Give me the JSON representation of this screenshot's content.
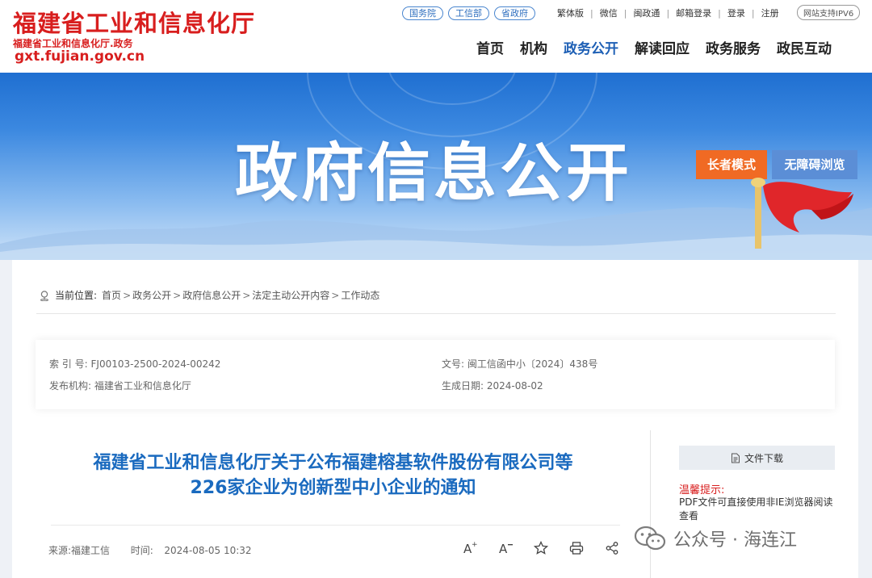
{
  "header": {
    "site_title": "福建省工业和信息化厅",
    "site_subtitle": "福建省工业和信息化厅.政务",
    "site_url": "gxt.fujian.gov.cn",
    "pills": [
      "国务院",
      "工信部",
      "省政府"
    ],
    "mini_links": [
      "繁体版",
      "微信",
      "闽政通",
      "邮箱登录",
      "登录",
      "注册"
    ],
    "ipv6": "网站支持IPV6",
    "nav": [
      {
        "label": "首页",
        "active": false
      },
      {
        "label": "机构",
        "active": false
      },
      {
        "label": "政务公开",
        "active": true
      },
      {
        "label": "解读回应",
        "active": false
      },
      {
        "label": "政务服务",
        "active": false
      },
      {
        "label": "政民互动",
        "active": false
      }
    ]
  },
  "banner": {
    "title": "政府信息公开",
    "elder_mode": "长者模式",
    "accessible": "无障碍浏览"
  },
  "breadcrumb": {
    "label": "当前位置:",
    "items": [
      "首页",
      "政务公开",
      "政府信息公开",
      "法定主动公开内容",
      "工作动态"
    ]
  },
  "meta": {
    "index_label": "索 引 号:",
    "index_value": "FJ00103-2500-2024-00242",
    "doc_label": "文号:",
    "doc_value": "闽工信函中小〔2024〕438号",
    "publisher_label": "发布机构:",
    "publisher_value": "福建省工业和信息化厅",
    "date_label": "生成日期:",
    "date_value": "2024-08-02"
  },
  "article": {
    "title_line1": "福建省工业和信息化厅关于公布福建榕基软件股份有限公司等",
    "title_line2": "226家企业为创新型中小企业的通知",
    "source": "来源:福建工信",
    "time_label": "时间:",
    "time_value": "2024-08-05 10:32"
  },
  "sidebar": {
    "download": "文件下载",
    "tip_title": "温馨提示:",
    "tip_text": "PDF文件可直接使用非IE浏览器阅读查看"
  },
  "watermark": {
    "text": "公众号 · 海连江"
  },
  "colors": {
    "brand_red": "#d81e1e",
    "nav_active": "#1d5fb5",
    "elder_btn": "#f06a24",
    "access_btn": "#5b8ed6"
  }
}
